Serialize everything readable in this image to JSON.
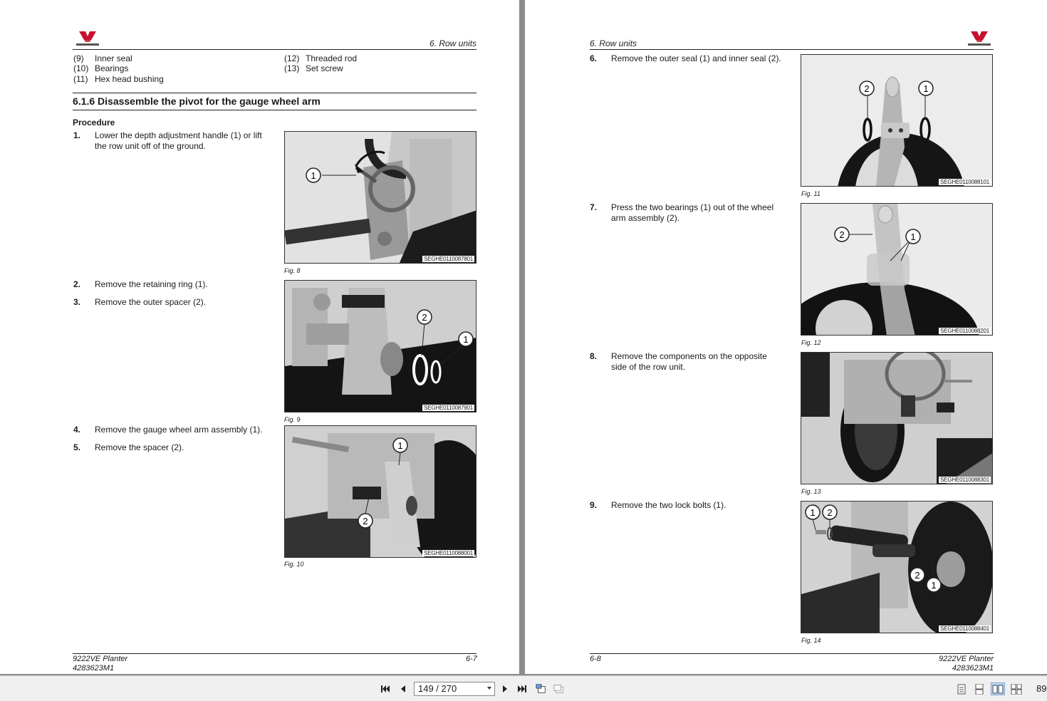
{
  "left_page": {
    "section_header": "6. Row units",
    "legend": [
      {
        "num": "(9)",
        "label": "Inner seal"
      },
      {
        "num": "(10)",
        "label": "Bearings"
      },
      {
        "num": "(11)",
        "label": "Hex head bushing"
      },
      {
        "num": "(12)",
        "label": "Threaded rod"
      },
      {
        "num": "(13)",
        "label": "Set screw"
      }
    ],
    "heading": "6.1.6  Disassemble the pivot for the gauge wheel arm",
    "procedure_label": "Procedure",
    "steps": [
      {
        "num": "1.",
        "text": "Lower the depth adjustment handle (1) or lift the row unit off of the ground."
      },
      {
        "num": "2.",
        "text": "Remove the retaining ring (1)."
      },
      {
        "num": "3.",
        "text": "Remove the outer spacer (2)."
      },
      {
        "num": "4.",
        "text": "Remove the gauge wheel arm assembly (1)."
      },
      {
        "num": "5.",
        "text": "Remove the spacer (2)."
      }
    ],
    "figures": [
      {
        "code": "SEGHE0110087801",
        "caption": "Fig. 8",
        "callouts": [
          "1"
        ]
      },
      {
        "code": "SEGHE0110087901",
        "caption": "Fig. 9",
        "callouts": [
          "2",
          "1"
        ]
      },
      {
        "code": "SEGHE0110088001",
        "caption": "Fig. 10",
        "callouts": [
          "1",
          "2"
        ]
      }
    ],
    "footer_model": "9222VE Planter",
    "footer_part": "4283623M1",
    "footer_page": "6-7"
  },
  "right_page": {
    "section_header": "6. Row units",
    "steps": [
      {
        "num": "6.",
        "text": "Remove the outer seal (1) and inner seal (2)."
      },
      {
        "num": "7.",
        "text": "Press the two bearings (1) out of the wheel arm assembly (2)."
      },
      {
        "num": "8.",
        "text": "Remove the components on the opposite side of the row unit."
      },
      {
        "num": "9.",
        "text": "Remove the two lock bolts (1)."
      }
    ],
    "figures": [
      {
        "code": "SEGHE0110088101",
        "caption": "Fig. 11",
        "callouts": [
          "2",
          "1"
        ]
      },
      {
        "code": "SEGHE0110088201",
        "caption": "Fig. 12",
        "callouts": [
          "2",
          "1"
        ]
      },
      {
        "code": "SEGHE0110088301",
        "caption": "Fig. 13",
        "callouts": []
      },
      {
        "code": "SEGHE0110088401",
        "caption": "Fig. 14",
        "callouts": [
          "1",
          "2",
          "2",
          "1"
        ]
      }
    ],
    "footer_page": "6-8",
    "footer_model": "9222VE Planter",
    "footer_part": "4283623M1"
  },
  "toolbar": {
    "page_indicator": "149 / 270",
    "zoom": "89",
    "icons": [
      "first-page-icon",
      "prev-page-icon",
      "next-page-icon",
      "last-page-icon",
      "fit-page-icon",
      "fit-width-icon",
      "single-page-icon",
      "continuous-icon",
      "facing-icon",
      "continuous-facing-icon"
    ]
  },
  "colors": {
    "brand_red": "#c8102e",
    "viewer_bg": "#8c8c8c",
    "toolbar_bg": "#f0f0f0"
  }
}
